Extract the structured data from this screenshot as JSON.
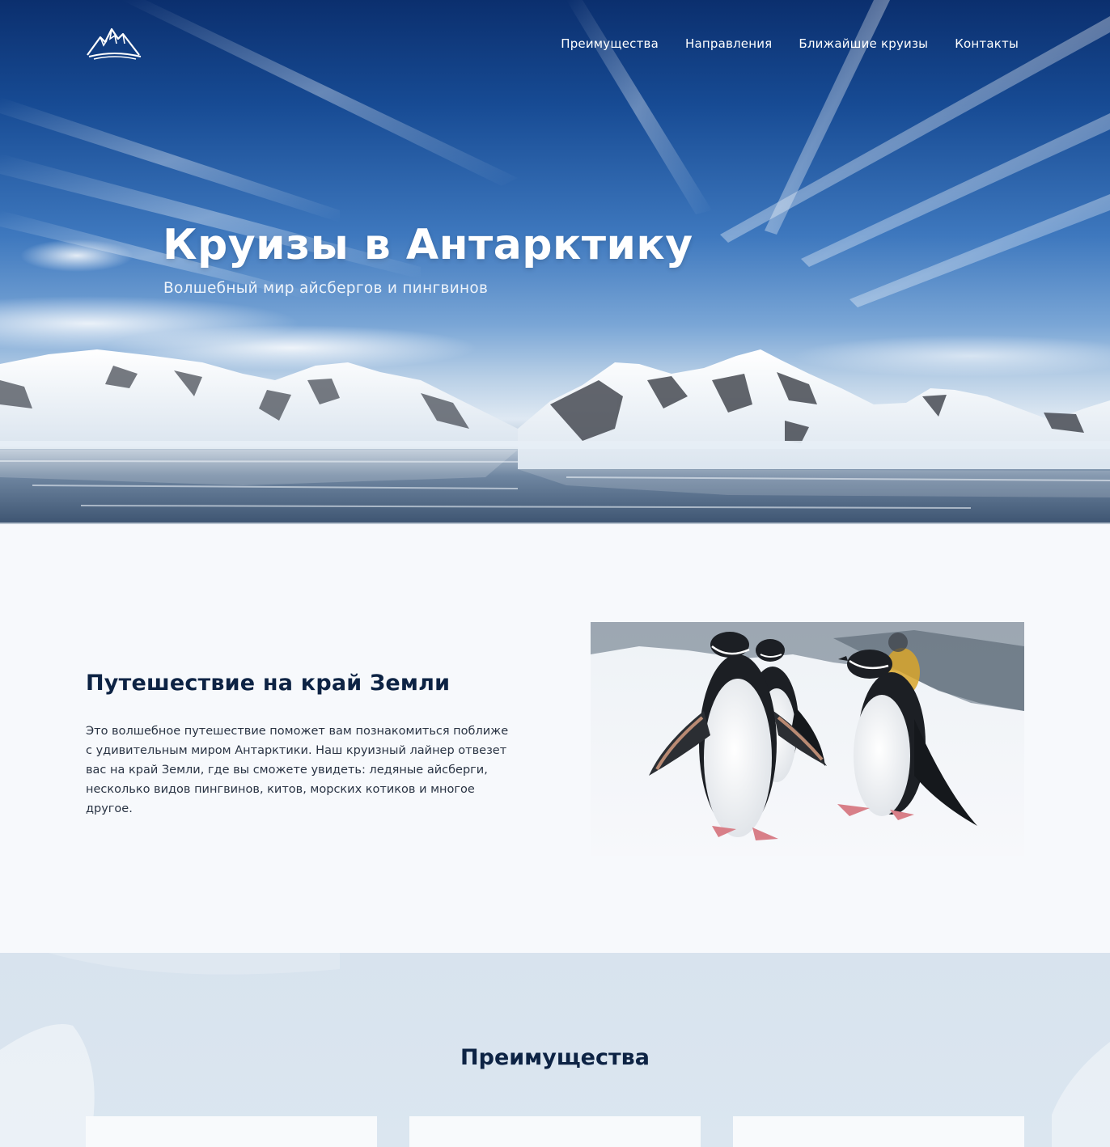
{
  "header": {
    "logo_icon": "mountain-logo-icon",
    "nav": [
      {
        "label": "Преимущества"
      },
      {
        "label": "Направления"
      },
      {
        "label": "Ближайшие круизы"
      },
      {
        "label": "Контакты"
      }
    ]
  },
  "hero": {
    "title": "Круизы в Антарктику",
    "subtitle": "Волшебный мир айсбергов и пингвинов"
  },
  "intro": {
    "title": "Путешествие на край Земли",
    "text": "Это волшебное путешествие поможет вам познакомиться поближе с удивительным миром Антарктики. Наш круизный лайнер отвезет вас на край Земли, где вы сможете увидеть: ледяные айсберги, несколько видов пингвинов, китов, морских котиков и многое другое."
  },
  "advantages": {
    "title": "Преимущества",
    "cards": [
      {},
      {},
      {}
    ]
  },
  "colors": {
    "heading": "#0d2344",
    "page_bg": "#f7f9fc",
    "section_bg": "#d8e3ee",
    "card_bg": "#f8fafc"
  }
}
